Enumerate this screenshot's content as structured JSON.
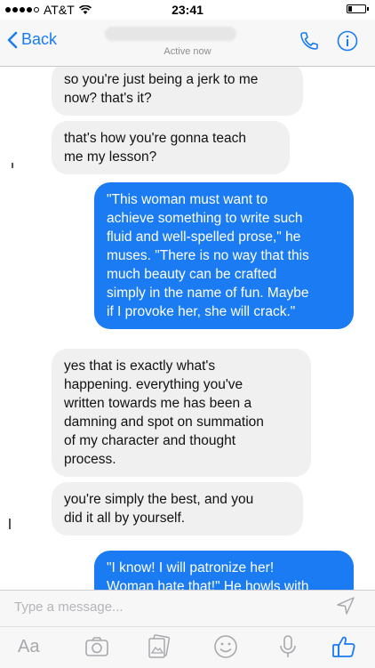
{
  "status_bar": {
    "carrier": "AT&T",
    "time": "23:41",
    "signal_bars_filled": 4,
    "signal_bars_total": 5
  },
  "header": {
    "back_label": "Back",
    "status": "Active now",
    "phone_icon": "phone-icon",
    "info_icon": "info-icon"
  },
  "messages": [
    {
      "direction": "incoming",
      "text": "so you're just being a jerk to me\nnow? that's it?"
    },
    {
      "direction": "incoming",
      "text": "that's how you're gonna teach\nme my lesson?"
    },
    {
      "direction": "outgoing",
      "text": "\"This woman must want to\nachieve something to write such\nfluid and well-spelled prose,\" he\nmuses. \"There is no way that this\nmuch beauty can be crafted\nsimply in the name of fun. Maybe\nif I provoke her, she will crack.\""
    },
    {
      "direction": "incoming",
      "text": "yes that is exactly what's\nhappening. everything you've\nwritten towards me has been a\ndamning and spot on summation\nof my character and thought\nprocess."
    },
    {
      "direction": "incoming",
      "text": "you're simply the best, and you\ndid it all by yourself."
    },
    {
      "direction": "outgoing",
      "text": "\"I know! I will patronize her!\nWoman hate that!\" He howls with"
    }
  ],
  "composer": {
    "placeholder": "Type a message...",
    "toolbar": {
      "text_format": "Aa",
      "icons": [
        "camera-icon",
        "photo-icon",
        "emoji-icon",
        "microphone-icon",
        "like-icon"
      ]
    }
  },
  "colors": {
    "accent": "#1a7bf2",
    "incoming_bubble": "#f0f0f0",
    "outgoing_bubble": "#1a7bf2",
    "placeholder": "#b5b5ba"
  }
}
